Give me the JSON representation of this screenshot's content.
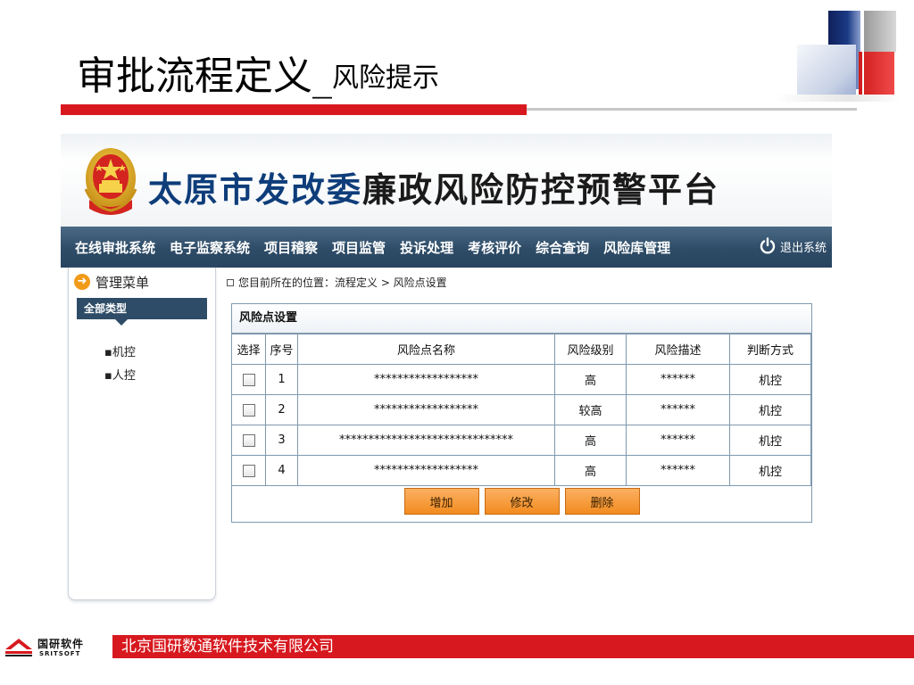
{
  "slide": {
    "title_main": "审批流程定义_",
    "title_sub": "风险提示"
  },
  "app": {
    "banner_title_part1": "太原市发改委",
    "banner_title_part2": "廉政风险防控预警平台",
    "nav": [
      "在线审批系统",
      "电子监察系统",
      "项目稽察",
      "项目监管",
      "投诉处理",
      "考核评价",
      "综合查询",
      "风险库管理"
    ],
    "logout_label": "退出系统"
  },
  "sidebar": {
    "menu_title": "管理菜单",
    "category": "全部类型",
    "items": [
      "机控",
      "人控"
    ]
  },
  "breadcrumb": {
    "text": "您目前所在的位置：流程定义 > 风险点设置"
  },
  "panel": {
    "title": "风险点设置",
    "columns": [
      "选择",
      "序号",
      "风险点名称",
      "风险级别",
      "风险描述",
      "判断方式"
    ],
    "rows": [
      {
        "no": "1",
        "name": "******************",
        "level": "高",
        "desc": "******",
        "method": "机控"
      },
      {
        "no": "2",
        "name": "******************",
        "level": "较高",
        "desc": "******",
        "method": "机控"
      },
      {
        "no": "3",
        "name": "******************************",
        "level": "高",
        "desc": "******",
        "method": "机控"
      },
      {
        "no": "4",
        "name": "******************",
        "level": "高",
        "desc": "******",
        "method": "机控"
      }
    ],
    "buttons": {
      "add": "增加",
      "edit": "修改",
      "delete": "删除"
    }
  },
  "footer": {
    "company": "北京国研数通软件技术有限公司",
    "logo_cn": "国研软件",
    "logo_en": "SRITSOFT"
  },
  "colors": {
    "accent_red": "#d7191f",
    "nav_blue": "#2e4c67",
    "button_orange": "#f28b1f"
  }
}
